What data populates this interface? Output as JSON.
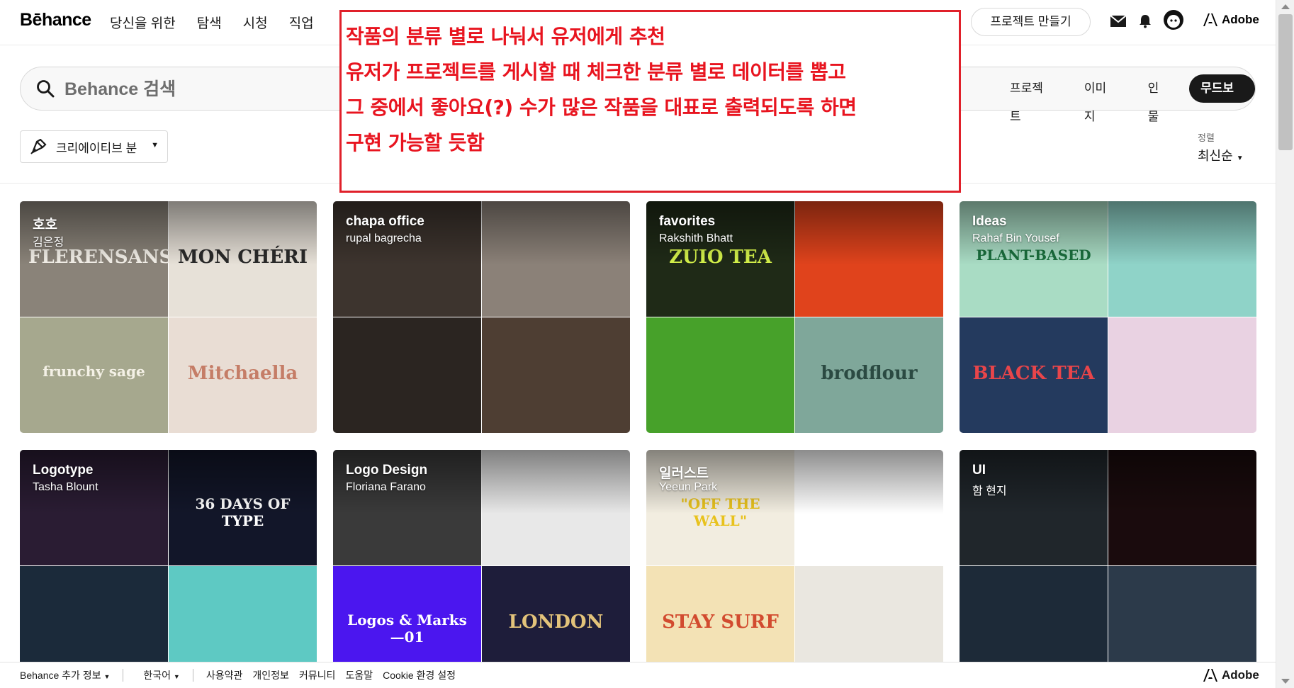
{
  "header": {
    "logo": "Bēhance",
    "nav": [
      "당신을 위한",
      "탐색",
      "시청",
      "직업"
    ],
    "create_button": "프로젝트 만들기",
    "adobe": "Adobe"
  },
  "search": {
    "placeholder": "Behance 검색",
    "tabs": [
      "프로젝트",
      "이미지",
      "인물",
      "무드보드"
    ],
    "active_tab": "무드보드"
  },
  "filter": {
    "label": "크리에이티브 분"
  },
  "sort": {
    "label": "정렬",
    "value": "최신순"
  },
  "annotation": {
    "lines": [
      "작품의 분류 별로 나눠서 유저에게 추천",
      "유저가 프로젝트를 게시할 때 체크한 분류 별로 데이터를 뽑고",
      "그 중에서 좋아요(?) 수가 많은 작품을 대표로 출력되도록 하면",
      "구현 가능할 듯함"
    ],
    "color": "#e8141f"
  },
  "boards": [
    {
      "title": "호호",
      "owner": "김은정",
      "tiles": [
        {
          "bg": "#8a8379",
          "text": "FLERENSANS",
          "color": "#f3efe8"
        },
        {
          "bg": "#e7e1d8",
          "text": "MON CHÉRI",
          "color": "#2a2a2a"
        },
        {
          "bg": "#a6a88e",
          "text": "frunchy sage",
          "color": "#f4f1e6"
        },
        {
          "bg": "#e9ddd4",
          "text": "Mitchaella",
          "color": "#c57d67"
        }
      ]
    },
    {
      "title": "chapa office",
      "owner": "rupal bagrecha",
      "tiles": [
        {
          "bg": "#3d342e",
          "text": "",
          "color": "#fff"
        },
        {
          "bg": "#8b8178",
          "text": "",
          "color": "#fff"
        },
        {
          "bg": "#2b2521",
          "text": "",
          "color": "#fff"
        },
        {
          "bg": "#4e3e33",
          "text": "",
          "color": "#fff"
        }
      ]
    },
    {
      "title": "favorites",
      "owner": "Rakshith Bhatt",
      "tiles": [
        {
          "bg": "#1f2a17",
          "text": "ZUIO TEA",
          "color": "#d5f24a"
        },
        {
          "bg": "#e0431c",
          "text": "",
          "color": "#fff"
        },
        {
          "bg": "#47a12a",
          "text": "",
          "color": "#fff"
        },
        {
          "bg": "#7fa79a",
          "text": "brodflour",
          "color": "#2b4a42"
        }
      ]
    },
    {
      "title": "Ideas",
      "owner": "Rahaf Bin Yousef",
      "tiles": [
        {
          "bg": "#a9dcc4",
          "text": "PLANT-BASED",
          "color": "#1a6f3d"
        },
        {
          "bg": "#8fd3c8",
          "text": "",
          "color": "#fff"
        },
        {
          "bg": "#243a5e",
          "text": "BLACK TEA",
          "color": "#e8454a"
        },
        {
          "bg": "#e9d2e2",
          "text": "",
          "color": "#5a4a80"
        }
      ]
    },
    {
      "title": "Logotype",
      "owner": "Tasha Blount",
      "tiles": [
        {
          "bg": "#2a1c33",
          "text": "",
          "color": "#fff"
        },
        {
          "bg": "#121629",
          "text": "36 DAYS OF TYPE",
          "color": "#ffffff"
        },
        {
          "bg": "#1b2a3a",
          "text": "",
          "color": "#fff"
        },
        {
          "bg": "#5ec9c3",
          "text": "",
          "color": "#fff"
        }
      ]
    },
    {
      "title": "Logo Design",
      "owner": "Floriana Farano",
      "tiles": [
        {
          "bg": "#3a3a3a",
          "text": "",
          "color": "#fff"
        },
        {
          "bg": "#e8e8e8",
          "text": "",
          "color": "#0d47a1"
        },
        {
          "bg": "#4b16ef",
          "text": "Logos & Marks—01",
          "color": "#ffffff"
        },
        {
          "bg": "#1e1d3a",
          "text": "LONDON",
          "color": "#e3c37a"
        }
      ]
    },
    {
      "title": "일러스트",
      "owner": "Yeeun Park",
      "tiles": [
        {
          "bg": "#f2ede0",
          "text": "\"OFF THE WALL\"",
          "color": "#e8c21d"
        },
        {
          "bg": "#ffffff",
          "text": "",
          "color": "#222"
        },
        {
          "bg": "#f3e2b5",
          "text": "STAY SURF",
          "color": "#d24b2f"
        },
        {
          "bg": "#eae7e0",
          "text": "",
          "color": "#222"
        }
      ]
    },
    {
      "title": "UI",
      "owner": "함 현지",
      "tiles": [
        {
          "bg": "#20262b",
          "text": "",
          "color": "#fff"
        },
        {
          "bg": "#1a0b0d",
          "text": "",
          "color": "#ff3345"
        },
        {
          "bg": "#1d2a38",
          "text": "",
          "color": "#fff"
        },
        {
          "bg": "#2c3a4a",
          "text": "",
          "color": "#fff"
        }
      ]
    }
  ],
  "footer": {
    "more": "Behance 추가 정보",
    "language": "한국어",
    "links": [
      "사용약관",
      "개인정보",
      "커뮤니티",
      "도움말",
      "Cookie 환경 설정"
    ],
    "adobe": "Adobe"
  }
}
